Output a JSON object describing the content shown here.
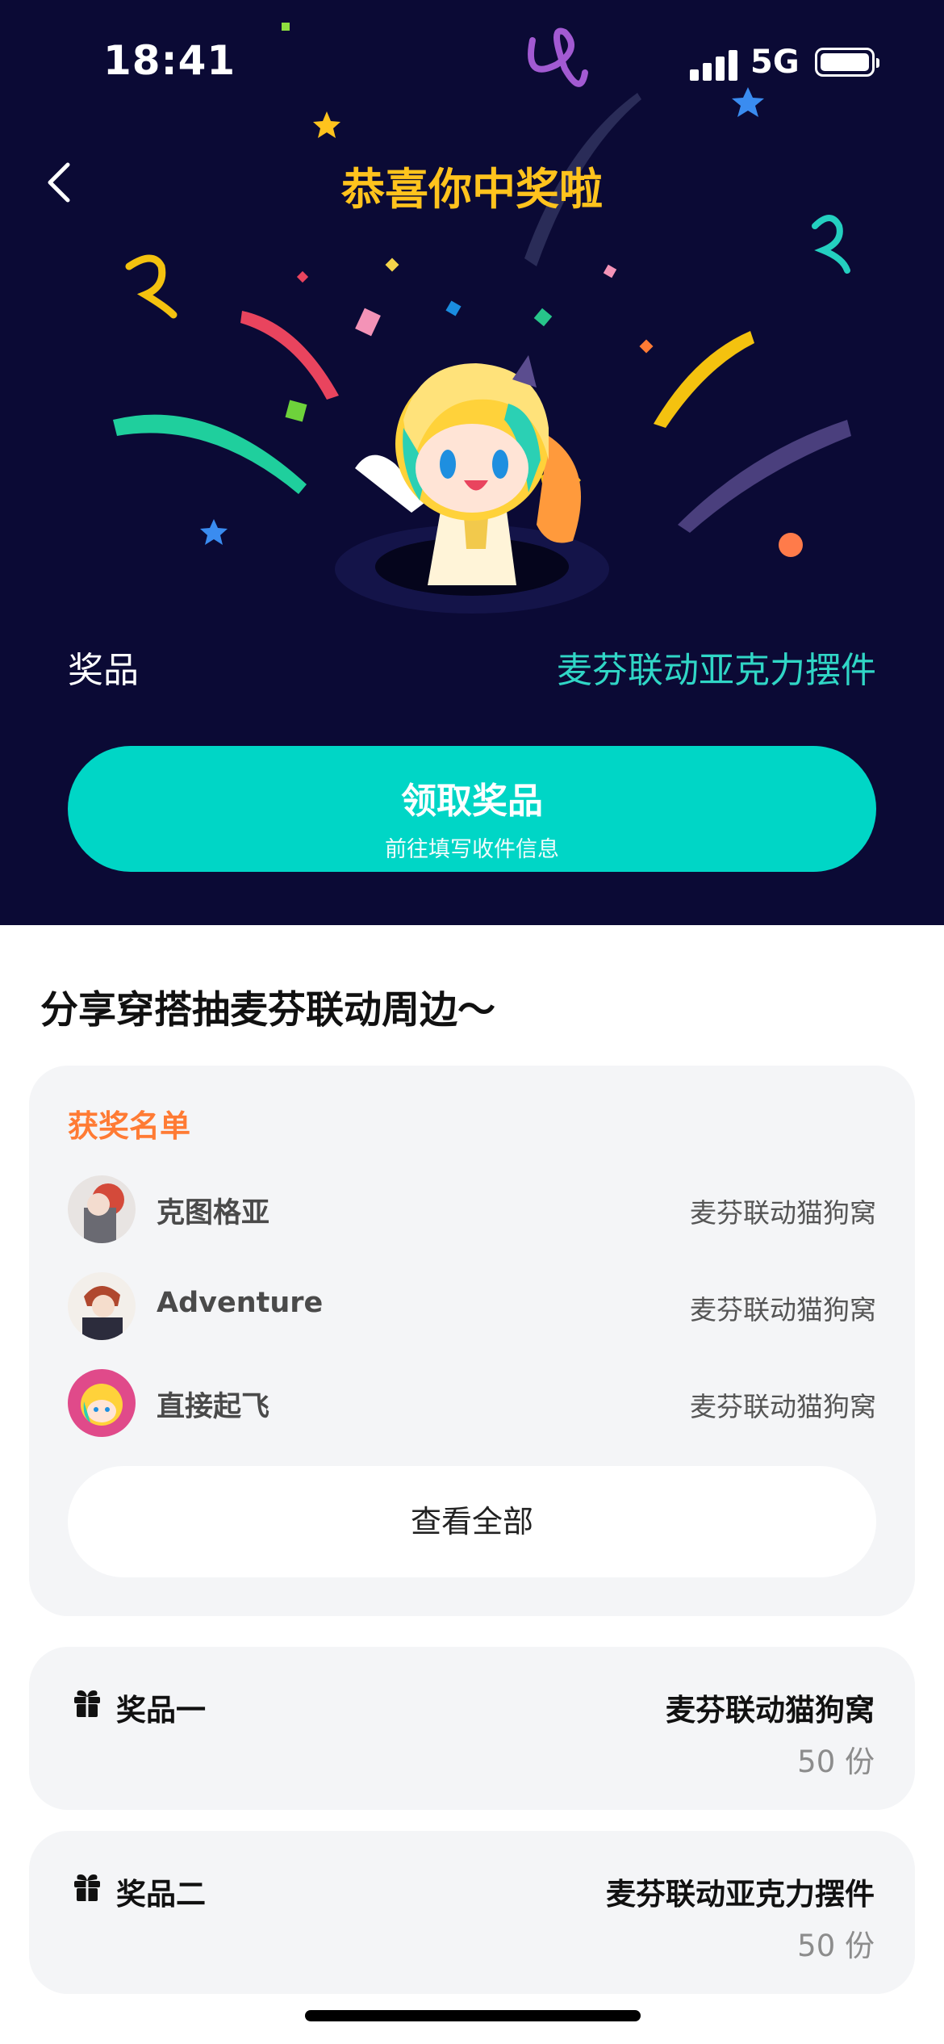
{
  "status_bar": {
    "time": "18:41",
    "network": "5G"
  },
  "header": {
    "title": "恭喜你中奖啦"
  },
  "prize": {
    "label": "奖品",
    "value": "麦芬联动亚克力摆件"
  },
  "claim_button": {
    "label": "领取奖品",
    "sublabel": "前往填写收件信息"
  },
  "share_section": {
    "title": "分享穿搭抽麦芬联动周边～"
  },
  "winners": {
    "heading": "获奖名单",
    "rows": [
      {
        "name": "克图格亚",
        "prize": "麦芬联动猫狗窝"
      },
      {
        "name": "Adventure",
        "prize": "麦芬联动猫狗窝"
      },
      {
        "name": "直接起飞",
        "prize": "麦芬联动猫狗窝"
      }
    ],
    "view_all_label": "查看全部"
  },
  "prize_list": [
    {
      "label": "奖品一",
      "title": "麦芬联动猫狗窝",
      "count": "50 份"
    },
    {
      "label": "奖品二",
      "title": "麦芬联动亚克力摆件",
      "count": "50 份"
    }
  ],
  "colors": {
    "banner_bg": "#0b0a35",
    "accent_teal": "#00d6c6",
    "title_yellow": "#ffc31d",
    "winners_heading": "#ff7b34",
    "card_bg": "#f4f5f7"
  },
  "icons": [
    "back-arrow-icon",
    "signal-icon",
    "battery-icon",
    "gift-icon"
  ]
}
